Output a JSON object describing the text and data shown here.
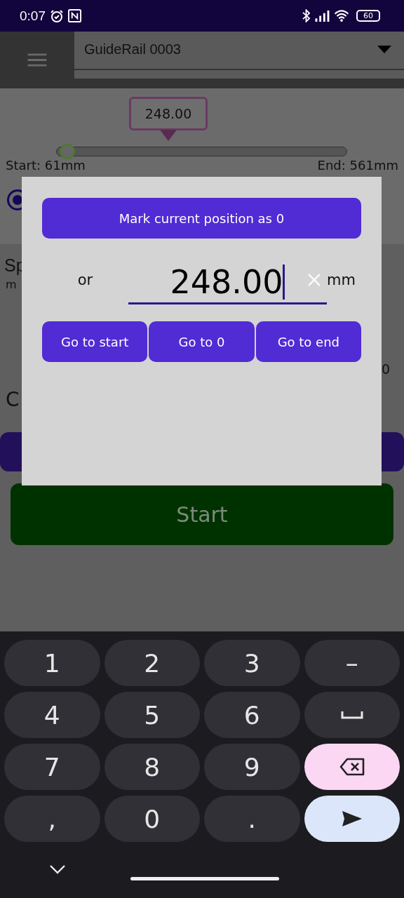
{
  "status_bar": {
    "time": "0:07",
    "battery": "60"
  },
  "app_bar": {
    "selector": "GuideRail 0003"
  },
  "slider": {
    "tooltip": "248.00",
    "level": 0.02,
    "start_label": "Start: 61mm",
    "end_label": "End: 561mm"
  },
  "radio": {
    "selected": true
  },
  "background_texts": {
    "speed_label": "Sp",
    "speed_unit": "m",
    "value": "0",
    "label": "C"
  },
  "start_button": "Start",
  "dialog": {
    "mark_button": "Mark current position as 0",
    "or_label": "or",
    "position_field": {
      "value": "248.00"
    },
    "unit": "mm",
    "buttons": [
      "Go to start",
      "Go to 0",
      "Go to end"
    ]
  },
  "keyboard": {
    "rows": [
      [
        {
          "kind": "char",
          "label": "1"
        },
        {
          "kind": "char",
          "label": "2"
        },
        {
          "kind": "char",
          "label": "3"
        },
        {
          "kind": "char",
          "label": "–"
        }
      ],
      [
        {
          "kind": "char",
          "label": "4"
        },
        {
          "kind": "char",
          "label": "5"
        },
        {
          "kind": "char",
          "label": "6"
        },
        {
          "kind": "space"
        }
      ],
      [
        {
          "kind": "char",
          "label": "7"
        },
        {
          "kind": "char",
          "label": "8"
        },
        {
          "kind": "char",
          "label": "9"
        },
        {
          "kind": "backspace"
        }
      ],
      [
        {
          "kind": "char",
          "label": ","
        },
        {
          "kind": "char",
          "label": "0"
        },
        {
          "kind": "char",
          "label": "."
        },
        {
          "kind": "enter"
        }
      ]
    ]
  }
}
